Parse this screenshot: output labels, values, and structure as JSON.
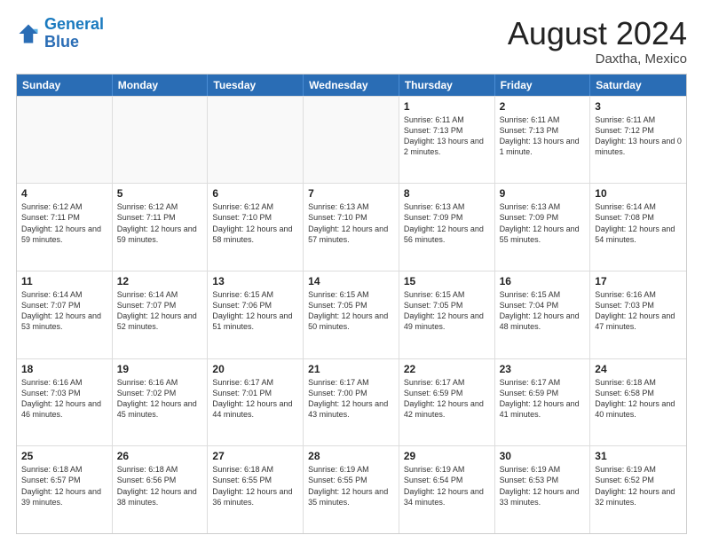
{
  "header": {
    "logo_line1": "General",
    "logo_line2": "Blue",
    "month": "August 2024",
    "location": "Daxtha, Mexico"
  },
  "days_of_week": [
    "Sunday",
    "Monday",
    "Tuesday",
    "Wednesday",
    "Thursday",
    "Friday",
    "Saturday"
  ],
  "rows": [
    [
      {
        "day": "",
        "empty": true
      },
      {
        "day": "",
        "empty": true
      },
      {
        "day": "",
        "empty": true
      },
      {
        "day": "",
        "empty": true
      },
      {
        "day": "1",
        "sunrise": "6:11 AM",
        "sunset": "7:13 PM",
        "daylight": "13 hours and 2 minutes."
      },
      {
        "day": "2",
        "sunrise": "6:11 AM",
        "sunset": "7:13 PM",
        "daylight": "13 hours and 1 minute."
      },
      {
        "day": "3",
        "sunrise": "6:11 AM",
        "sunset": "7:12 PM",
        "daylight": "13 hours and 0 minutes."
      }
    ],
    [
      {
        "day": "4",
        "sunrise": "6:12 AM",
        "sunset": "7:11 PM",
        "daylight": "12 hours and 59 minutes."
      },
      {
        "day": "5",
        "sunrise": "6:12 AM",
        "sunset": "7:11 PM",
        "daylight": "12 hours and 59 minutes."
      },
      {
        "day": "6",
        "sunrise": "6:12 AM",
        "sunset": "7:10 PM",
        "daylight": "12 hours and 58 minutes."
      },
      {
        "day": "7",
        "sunrise": "6:13 AM",
        "sunset": "7:10 PM",
        "daylight": "12 hours and 57 minutes."
      },
      {
        "day": "8",
        "sunrise": "6:13 AM",
        "sunset": "7:09 PM",
        "daylight": "12 hours and 56 minutes."
      },
      {
        "day": "9",
        "sunrise": "6:13 AM",
        "sunset": "7:09 PM",
        "daylight": "12 hours and 55 minutes."
      },
      {
        "day": "10",
        "sunrise": "6:14 AM",
        "sunset": "7:08 PM",
        "daylight": "12 hours and 54 minutes."
      }
    ],
    [
      {
        "day": "11",
        "sunrise": "6:14 AM",
        "sunset": "7:07 PM",
        "daylight": "12 hours and 53 minutes."
      },
      {
        "day": "12",
        "sunrise": "6:14 AM",
        "sunset": "7:07 PM",
        "daylight": "12 hours and 52 minutes."
      },
      {
        "day": "13",
        "sunrise": "6:15 AM",
        "sunset": "7:06 PM",
        "daylight": "12 hours and 51 minutes."
      },
      {
        "day": "14",
        "sunrise": "6:15 AM",
        "sunset": "7:05 PM",
        "daylight": "12 hours and 50 minutes."
      },
      {
        "day": "15",
        "sunrise": "6:15 AM",
        "sunset": "7:05 PM",
        "daylight": "12 hours and 49 minutes."
      },
      {
        "day": "16",
        "sunrise": "6:15 AM",
        "sunset": "7:04 PM",
        "daylight": "12 hours and 48 minutes."
      },
      {
        "day": "17",
        "sunrise": "6:16 AM",
        "sunset": "7:03 PM",
        "daylight": "12 hours and 47 minutes."
      }
    ],
    [
      {
        "day": "18",
        "sunrise": "6:16 AM",
        "sunset": "7:03 PM",
        "daylight": "12 hours and 46 minutes."
      },
      {
        "day": "19",
        "sunrise": "6:16 AM",
        "sunset": "7:02 PM",
        "daylight": "12 hours and 45 minutes."
      },
      {
        "day": "20",
        "sunrise": "6:17 AM",
        "sunset": "7:01 PM",
        "daylight": "12 hours and 44 minutes."
      },
      {
        "day": "21",
        "sunrise": "6:17 AM",
        "sunset": "7:00 PM",
        "daylight": "12 hours and 43 minutes."
      },
      {
        "day": "22",
        "sunrise": "6:17 AM",
        "sunset": "6:59 PM",
        "daylight": "12 hours and 42 minutes."
      },
      {
        "day": "23",
        "sunrise": "6:17 AM",
        "sunset": "6:59 PM",
        "daylight": "12 hours and 41 minutes."
      },
      {
        "day": "24",
        "sunrise": "6:18 AM",
        "sunset": "6:58 PM",
        "daylight": "12 hours and 40 minutes."
      }
    ],
    [
      {
        "day": "25",
        "sunrise": "6:18 AM",
        "sunset": "6:57 PM",
        "daylight": "12 hours and 39 minutes."
      },
      {
        "day": "26",
        "sunrise": "6:18 AM",
        "sunset": "6:56 PM",
        "daylight": "12 hours and 38 minutes."
      },
      {
        "day": "27",
        "sunrise": "6:18 AM",
        "sunset": "6:55 PM",
        "daylight": "12 hours and 36 minutes."
      },
      {
        "day": "28",
        "sunrise": "6:19 AM",
        "sunset": "6:55 PM",
        "daylight": "12 hours and 35 minutes."
      },
      {
        "day": "29",
        "sunrise": "6:19 AM",
        "sunset": "6:54 PM",
        "daylight": "12 hours and 34 minutes."
      },
      {
        "day": "30",
        "sunrise": "6:19 AM",
        "sunset": "6:53 PM",
        "daylight": "12 hours and 33 minutes."
      },
      {
        "day": "31",
        "sunrise": "6:19 AM",
        "sunset": "6:52 PM",
        "daylight": "12 hours and 32 minutes."
      }
    ]
  ]
}
